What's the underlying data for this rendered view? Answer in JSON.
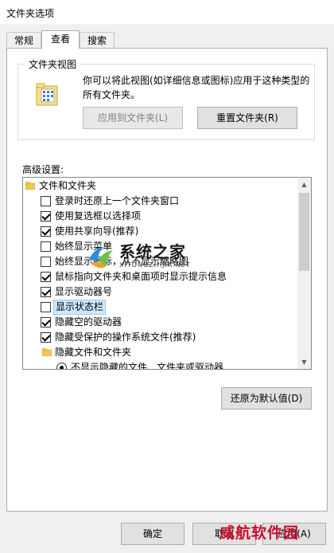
{
  "window": {
    "title": "文件夹选项"
  },
  "tabs": [
    {
      "label": "常规"
    },
    {
      "label": "查看"
    },
    {
      "label": "搜索"
    }
  ],
  "folder_views": {
    "group_label": "文件夹视图",
    "description": "你可以将此视图(如详细信息或图标)应用于这种类型的所有文件夹。",
    "apply_button": "应用到文件夹(L)",
    "reset_button": "重置文件夹(R)"
  },
  "advanced": {
    "label": "高级设置:",
    "items": [
      {
        "type": "folder",
        "label": "文件和文件夹"
      },
      {
        "type": "checkbox",
        "checked": false,
        "label": "登录时还原上一个文件夹窗口"
      },
      {
        "type": "checkbox",
        "checked": true,
        "label": "使用复选框以选择项"
      },
      {
        "type": "checkbox",
        "checked": true,
        "label": "使用共享向导(推荐)"
      },
      {
        "type": "checkbox",
        "checked": false,
        "label": "始终显示菜单"
      },
      {
        "type": "checkbox",
        "checked": false,
        "label": "始终显示图标，从不显示缩略图"
      },
      {
        "type": "checkbox",
        "checked": true,
        "label": "鼠标指向文件夹和桌面项时显示提示信息"
      },
      {
        "type": "checkbox",
        "checked": true,
        "label": "显示驱动器号"
      },
      {
        "type": "checkbox",
        "checked": false,
        "label": "显示状态栏",
        "selected": true
      },
      {
        "type": "checkbox",
        "checked": true,
        "label": "隐藏空的驱动器"
      },
      {
        "type": "checkbox",
        "checked": true,
        "label": "隐藏受保护的操作系统文件(推荐)"
      },
      {
        "type": "folder",
        "label": "隐藏文件和文件夹"
      },
      {
        "type": "radio",
        "checked": true,
        "label": "不显示隐藏的文件、文件夹或驱动器"
      }
    ],
    "restore_defaults_button": "还原为默认值(D)"
  },
  "footer": {
    "ok_button": "确定",
    "cancel_button": "取消",
    "apply_button": "应用(A)"
  },
  "watermarks": {
    "center_title": "系统之家",
    "center_sub": "XITONGZHIJIA.NET",
    "corner": "威航软件园"
  },
  "colors": {
    "selection": "#cce8ff",
    "default_button_border": "#0078d7",
    "corner_watermark": "#c8102e"
  }
}
